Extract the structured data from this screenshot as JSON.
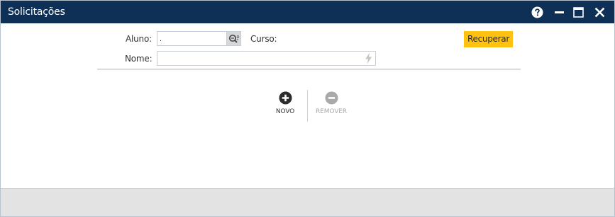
{
  "window": {
    "title": "Solicitações"
  },
  "form": {
    "aluno_label": "Aluno:",
    "aluno_value": ".",
    "curso_label": "Curso:",
    "nome_label": "Nome:",
    "nome_value": ""
  },
  "buttons": {
    "recuperar": "Recuperar",
    "novo": "NOVO",
    "remover": "REMOVER"
  },
  "icons": {
    "help": "help-circle-icon",
    "minimize": "minimize-icon",
    "maximize": "maximize-icon",
    "close": "close-icon",
    "lookup": "search-lookup-icon",
    "bolt": "lightning-bolt-icon",
    "add": "plus-circle-icon",
    "remove": "minus-circle-icon"
  },
  "colors": {
    "titlebar": "#0e3057",
    "accent_button": "#ffc20e",
    "footer": "#e3e3e3"
  }
}
